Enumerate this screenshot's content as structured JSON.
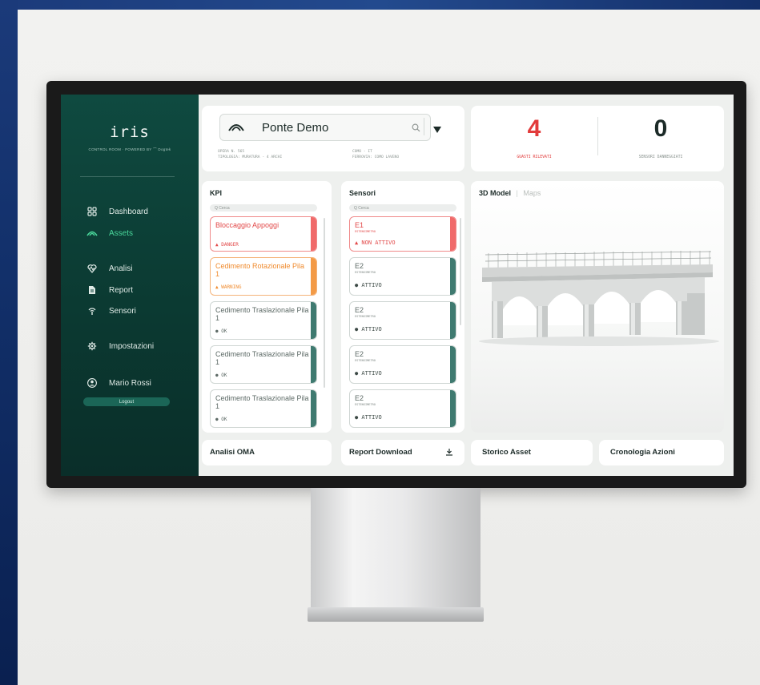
{
  "app": {
    "brand": "iris",
    "brand_sub": "CONTROL ROOM · POWERED BY ⌒ Dogtek"
  },
  "sidebar": {
    "items": [
      {
        "label": "Dashboard",
        "icon": "grid-icon",
        "active": false
      },
      {
        "label": "Assets",
        "icon": "bridge-icon",
        "active": true
      },
      {
        "label": "Analisi",
        "icon": "chart-icon",
        "active": false
      },
      {
        "label": "Report",
        "icon": "document-icon",
        "active": false
      },
      {
        "label": "Sensori",
        "icon": "signal-icon",
        "active": false
      },
      {
        "label": "Impostazioni",
        "icon": "gear-icon",
        "active": false
      }
    ],
    "user": {
      "name": "Mario Rossi",
      "logout": "Logout"
    }
  },
  "asset": {
    "name": "Ponte Demo",
    "meta_left": [
      "OPERA N. 565",
      "TIPOLOGIA: MURATURA - 4 ARCHI"
    ],
    "meta_right": [
      "COMO - IT",
      "FERROVIA: COMO LAVENO"
    ]
  },
  "stats": [
    {
      "value": "4",
      "label": "GUASTI RILEVATI",
      "color": "#e23b3b"
    },
    {
      "value": "0",
      "label": "SENSORI DANNEGGIATI",
      "color": "#1c2b28"
    }
  ],
  "kpi": {
    "title": "KPI",
    "search_placeholder": "Q Cerca",
    "items": [
      {
        "title": "Bloccaggio Appoggi",
        "status": "▲ DANGER",
        "color": "#e24848",
        "bar": "#f06a6a",
        "border": "#f08a8a"
      },
      {
        "title": "Cedimento Rotazionale Pila 1",
        "status": "▲ WARNING",
        "color": "#f08b2e",
        "bar": "#f39a46",
        "border": "#f5b47a"
      },
      {
        "title": "Cedimento Traslazionale Pila 1",
        "status": "● OK",
        "color": "#5d6a66",
        "bar": "#3f7a70",
        "border": "#cfd6d3"
      },
      {
        "title": "Cedimento Traslazionale Pila 1",
        "status": "● OK",
        "color": "#5d6a66",
        "bar": "#3f7a70",
        "border": "#cfd6d3"
      },
      {
        "title": "Cedimento Traslazionale Pila 1",
        "status": "● OK",
        "color": "#5d6a66",
        "bar": "#3f7a70",
        "border": "#cfd6d3"
      }
    ]
  },
  "sensori": {
    "title": "Sensori",
    "search_placeholder": "Q Cerca",
    "items": [
      {
        "id": "E1",
        "type": "ESTENSIMETRO",
        "status": "▲ NON ATTIVO",
        "color": "#e24848",
        "bar": "#f06a6a",
        "border": "#f08a8a"
      },
      {
        "id": "E2",
        "type": "ESTENSIMETRO",
        "status": "● ATTIVO",
        "color": "#3d4a46",
        "bar": "#3f7a70",
        "border": "#cfd6d3"
      },
      {
        "id": "E2",
        "type": "ESTENSIMETRO",
        "status": "● ATTIVO",
        "color": "#3d4a46",
        "bar": "#3f7a70",
        "border": "#cfd6d3"
      },
      {
        "id": "E2",
        "type": "ESTENSIMETRO",
        "status": "● ATTIVO",
        "color": "#3d4a46",
        "bar": "#3f7a70",
        "border": "#cfd6d3"
      },
      {
        "id": "E2",
        "type": "ESTENSIMETRO",
        "status": "● ATTIVO",
        "color": "#3d4a46",
        "bar": "#3f7a70",
        "border": "#cfd6d3"
      }
    ]
  },
  "viewer": {
    "tab_active": "3D Model",
    "separator": "|",
    "tab_inactive": "Maps"
  },
  "bottom": {
    "analisi": "Analisi OMA",
    "report": "Report Download",
    "storico": "Storico Asset",
    "cronologia": "Cronologia Azioni"
  }
}
